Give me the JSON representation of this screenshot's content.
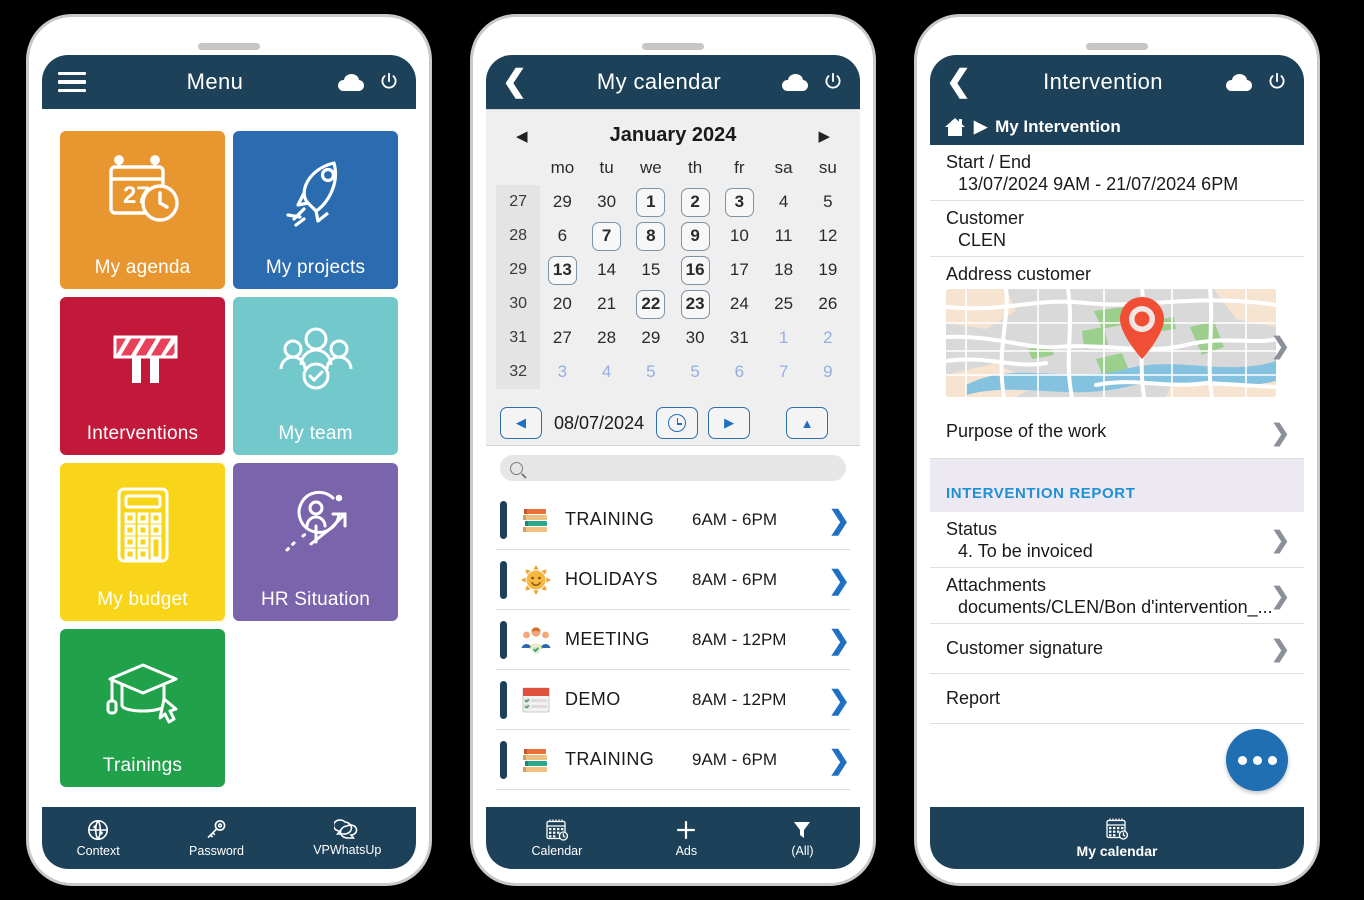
{
  "phone1": {
    "header": {
      "title": "Menu",
      "menu_icon": "hamburger-icon",
      "cloud_icon": "cloud-icon",
      "power_icon": "power-icon"
    },
    "tiles": [
      {
        "label": "My agenda",
        "icon": "calendar-clock-icon",
        "color": "#E8962F"
      },
      {
        "label": "My projects",
        "icon": "rocket-icon",
        "color": "#2B6CB0"
      },
      {
        "label": "Interventions",
        "icon": "roadblock-icon",
        "color": "#C2193A"
      },
      {
        "label": "My team",
        "icon": "team-check-icon",
        "color": "#73C8CC"
      },
      {
        "label": "My budget",
        "icon": "calculator-icon",
        "color": "#F8D518"
      },
      {
        "label": "HR Situation",
        "icon": "hr-growth-icon",
        "color": "#7A64AC"
      },
      {
        "label": "Trainings",
        "icon": "graduation-cap-icon",
        "color": "#22A14B"
      }
    ],
    "bottom_nav": [
      {
        "label": "Context",
        "icon": "globe-icon"
      },
      {
        "label": "Password",
        "icon": "key-icon"
      },
      {
        "label": "VPWhatsUp",
        "icon": "chat-bubbles-icon"
      }
    ]
  },
  "phone2": {
    "header": {
      "title": "My calendar",
      "back_icon": "back-chevron-icon",
      "cloud_icon": "cloud-icon",
      "power_icon": "power-icon"
    },
    "calendar": {
      "month_title": "January 2024",
      "prev_icon": "prev-month-arrow",
      "next_icon": "next-month-arrow",
      "weekday_headers": [
        "mo",
        "tu",
        "we",
        "th",
        "fr",
        "sa",
        "su"
      ],
      "weeks": [
        {
          "week_no": "27",
          "days": [
            {
              "n": "29"
            },
            {
              "n": "30"
            },
            {
              "n": "1",
              "sel": true
            },
            {
              "n": "2",
              "sel": true
            },
            {
              "n": "3",
              "sel": true
            },
            {
              "n": "4"
            },
            {
              "n": "5"
            }
          ]
        },
        {
          "week_no": "28",
          "days": [
            {
              "n": "6"
            },
            {
              "n": "7",
              "sel": true
            },
            {
              "n": "8",
              "sel": true
            },
            {
              "n": "9",
              "sel": true
            },
            {
              "n": "10"
            },
            {
              "n": "11"
            },
            {
              "n": "12"
            }
          ]
        },
        {
          "week_no": "29",
          "days": [
            {
              "n": "13",
              "sel": true
            },
            {
              "n": "14"
            },
            {
              "n": "15"
            },
            {
              "n": "16",
              "sel": true
            },
            {
              "n": "17"
            },
            {
              "n": "18"
            },
            {
              "n": "19"
            }
          ]
        },
        {
          "week_no": "30",
          "days": [
            {
              "n": "20"
            },
            {
              "n": "21"
            },
            {
              "n": "22",
              "sel": true
            },
            {
              "n": "23",
              "sel": true
            },
            {
              "n": "24"
            },
            {
              "n": "25"
            },
            {
              "n": "26"
            }
          ]
        },
        {
          "week_no": "31",
          "days": [
            {
              "n": "27"
            },
            {
              "n": "28"
            },
            {
              "n": "29"
            },
            {
              "n": "30"
            },
            {
              "n": "31"
            },
            {
              "n": "1",
              "out": true
            },
            {
              "n": "2",
              "out": true
            }
          ]
        },
        {
          "week_no": "32",
          "days": [
            {
              "n": "3",
              "out": true
            },
            {
              "n": "4",
              "out": true
            },
            {
              "n": "5",
              "out": true
            },
            {
              "n": "5",
              "out": true
            },
            {
              "n": "6",
              "out": true
            },
            {
              "n": "7",
              "out": true
            },
            {
              "n": "9",
              "out": true
            }
          ]
        }
      ]
    },
    "date_nav": {
      "prev_label": "◀",
      "date_value": "08/07/2024",
      "clock_icon": "clock-icon",
      "next_label": "▶",
      "up_label": "▲"
    },
    "search": {
      "placeholder": "",
      "value": "",
      "icon": "search-icon"
    },
    "events": [
      {
        "name": "TRAINING",
        "time": "6AM - 6PM",
        "icon": "books-icon"
      },
      {
        "name": "HOLIDAYS",
        "time": "8AM - 6PM",
        "icon": "sun-icon"
      },
      {
        "name": "MEETING",
        "time": "8AM - 12PM",
        "icon": "people-icon"
      },
      {
        "name": "DEMO",
        "time": "8AM - 12PM",
        "icon": "checklist-icon"
      },
      {
        "name": "TRAINING",
        "time": "9AM - 6PM",
        "icon": "books-icon"
      }
    ],
    "bottom_nav": [
      {
        "label": "Calendar",
        "icon": "calendar-clock-icon"
      },
      {
        "label": "Ads",
        "icon": "plus-icon"
      },
      {
        "label": "(All)",
        "icon": "filter-icon"
      }
    ]
  },
  "phone3": {
    "header": {
      "title": "Intervention",
      "back_icon": "back-chevron-icon",
      "cloud_icon": "cloud-icon",
      "power_icon": "power-icon"
    },
    "breadcrumb": {
      "home_icon": "home-icon",
      "separator": "▶",
      "label": "My Intervention"
    },
    "fields": [
      {
        "label": "Start / End",
        "value": "13/07/2024 9AM - 21/07/2024 6PM"
      },
      {
        "label": "Customer",
        "value": "CLEN"
      },
      {
        "label": "Address customer",
        "value": ""
      }
    ],
    "map": {
      "icon": "map-pin-icon",
      "chevron": "chevron-right-icon"
    },
    "purpose": {
      "label": "Purpose of the work"
    },
    "report_section": {
      "title": "INTERVENTION REPORT",
      "accent": "#1F8FD6"
    },
    "report_rows": [
      {
        "label": "Status",
        "value": "4. To be invoiced"
      },
      {
        "label": "Attachments",
        "value": "documents/CLEN/Bon d'intervention_..."
      },
      {
        "label": "Customer signature",
        "value": ""
      },
      {
        "label": "Report",
        "value": ""
      }
    ],
    "fab": {
      "icon": "more-dots-icon",
      "color": "#1F6FB2"
    },
    "bottom_nav": [
      {
        "label": "My calendar",
        "icon": "calendar-clock-icon"
      }
    ]
  }
}
